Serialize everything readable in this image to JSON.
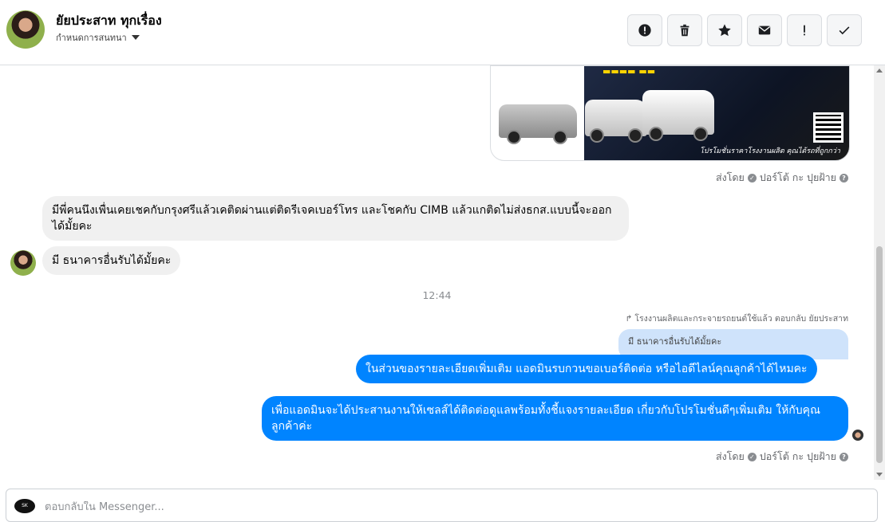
{
  "header": {
    "contact_name": "ยัยประสาท ทุกเรื่อง",
    "assign_label": "กำหนดการสนทนา",
    "toolbar": [
      {
        "icon": "alert-circle-icon",
        "tooltip": ""
      },
      {
        "icon": "trash-icon",
        "tooltip": ""
      },
      {
        "icon": "star-icon",
        "tooltip": ""
      },
      {
        "icon": "envelope-icon",
        "tooltip": ""
      },
      {
        "icon": "exclamation-icon",
        "tooltip": ""
      },
      {
        "icon": "checkmark-icon",
        "tooltip": ""
      }
    ]
  },
  "ad": {
    "caption": "โปรโมชั่นราคาโรงงานผลิต คุณได้รถที่ถูกกว่า"
  },
  "messages": {
    "sent_by_1": {
      "prefix": "ส่งโดย",
      "name": "ปอร์โต้ กะ ปุยฝ้าย"
    },
    "incoming_1": "มีพี่คนนึงเพื่นเคยเชคกับกรุงศรีแล้วเคติดผ่านแต่ติดรีเจคเบอร์โทร และโชคกับ CIMB แล้วแกติดไม่ส่งธกส.แบบนี้จะออกได้มั้ยคะ",
    "incoming_2": "มี ธนาคารอื่นรับได้มั้ยคะ",
    "time": "12:44",
    "reply_meta": "โรงงานผลิตและกระจายรถยนต์ใช้แล้ว ตอบกลับ ยัยประสาท",
    "reply_quote": "มี ธนาคารอื่นรับได้มั้ยคะ",
    "outgoing_1": "ในส่วนของรายละเอียดเพิ่มเติม แอดมินรบกวนขอเบอร์ติดต่อ หรือไอดีไลน์คุณลูกค้าได้ไหมคะ",
    "outgoing_2": "เพื่อแอดมินจะได้ประสานงานให้เซลส์ได้ติดต่อดูแลพร้อมทั้งชี้แจงรายละเอียด เกี่ยวกับโปรโมชั่นดีๆเพิ่มเติม ให้กับคุณลูกค้าค่ะ",
    "sent_by_2": {
      "prefix": "ส่งโดย",
      "name": "ปอร์โต้ กะ ปุยฝ้าย"
    }
  },
  "composer": {
    "placeholder": "ตอบกลับใน Messenger..."
  },
  "colors": {
    "outgoing_bubble": "#0084ff",
    "incoming_bubble": "#f0f0f0"
  }
}
